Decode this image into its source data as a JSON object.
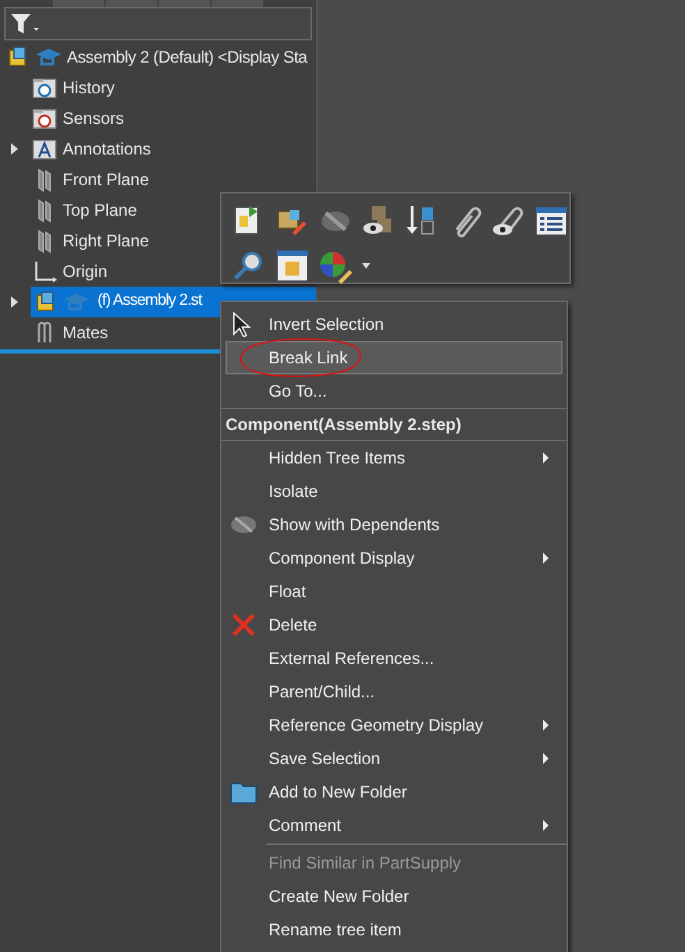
{
  "tree": {
    "root": {
      "label": "Assembly 2 (Default) <Display Sta"
    },
    "items": [
      {
        "label": "History",
        "selected": false
      },
      {
        "label": "Sensors",
        "selected": false
      },
      {
        "label": "Annotations",
        "selected": false,
        "expanded": false
      },
      {
        "label": "Front Plane",
        "selected": false
      },
      {
        "label": "Top Plane",
        "selected": false
      },
      {
        "label": "Right Plane",
        "selected": false
      },
      {
        "label": "Origin",
        "selected": false
      },
      {
        "label": "(f) Assembly 2.st",
        "selected": true,
        "expanded": false
      },
      {
        "label": "Mates",
        "selected": false
      }
    ]
  },
  "context_menu": {
    "items": [
      {
        "kind": "item",
        "label": "Invert Selection",
        "selected": false
      },
      {
        "kind": "item",
        "label": "Break Link",
        "selected": true
      },
      {
        "kind": "item",
        "label": "Go To...",
        "selected": false
      },
      {
        "kind": "header",
        "label": "Component(Assembly 2.step)"
      },
      {
        "kind": "item",
        "label": "Hidden Tree Items",
        "selected": false,
        "submenu": true
      },
      {
        "kind": "item",
        "label": "Isolate",
        "selected": false
      },
      {
        "kind": "item",
        "label": "Show with Dependents",
        "selected": false
      },
      {
        "kind": "item",
        "label": "Component Display",
        "selected": false,
        "submenu": true
      },
      {
        "kind": "item",
        "label": "Float",
        "selected": false
      },
      {
        "kind": "item",
        "label": "Delete",
        "selected": false
      },
      {
        "kind": "item",
        "label": "External References...",
        "selected": false
      },
      {
        "kind": "item",
        "label": "Parent/Child...",
        "selected": false
      },
      {
        "kind": "item",
        "label": "Reference Geometry Display",
        "selected": false,
        "submenu": true
      },
      {
        "kind": "item",
        "label": "Save Selection",
        "selected": false,
        "submenu": true
      },
      {
        "kind": "item",
        "label": "Add to New Folder",
        "selected": false
      },
      {
        "kind": "item",
        "label": "Comment",
        "selected": false,
        "submenu": true
      },
      {
        "kind": "separator"
      },
      {
        "kind": "item",
        "label": "Find Similar in PartSupply",
        "selected": false,
        "disabled": true
      },
      {
        "kind": "item",
        "label": "Create New Folder",
        "selected": false
      },
      {
        "kind": "item",
        "label": "Rename tree item",
        "selected": false
      }
    ]
  }
}
